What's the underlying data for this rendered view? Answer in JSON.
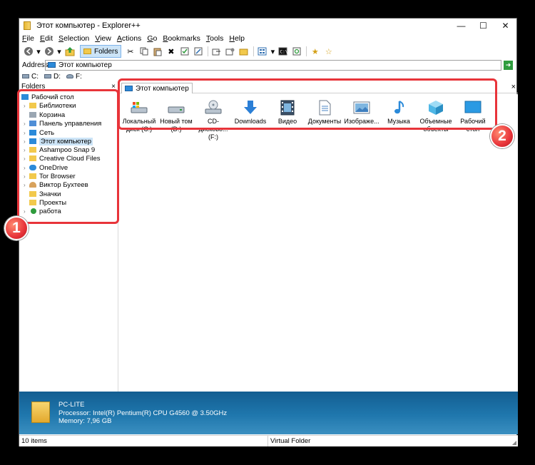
{
  "window": {
    "title": "Этот компьютер - Explorer++",
    "minimize": "—",
    "maximize": "☐",
    "close": "✕"
  },
  "menu": [
    {
      "first": "F",
      "rest": "ile"
    },
    {
      "first": "E",
      "rest": "dit"
    },
    {
      "first": "S",
      "rest": "election"
    },
    {
      "first": "V",
      "rest": "iew"
    },
    {
      "first": "A",
      "rest": "ctions"
    },
    {
      "first": "G",
      "rest": "o"
    },
    {
      "first": "B",
      "rest": "ookmarks"
    },
    {
      "first": "T",
      "rest": "ools"
    },
    {
      "first": "H",
      "rest": "elp"
    }
  ],
  "toolbar": {
    "folders_label": "Folders"
  },
  "address": {
    "label": "Address",
    "value": "Этот компьютер",
    "go": "➜"
  },
  "drives": [
    "C:",
    "D:",
    "F:"
  ],
  "folders_pane": {
    "title": "Folders",
    "close": "×",
    "items": [
      {
        "label": "Рабочий стол",
        "color": "#2b8ad9"
      },
      {
        "label": "Библиотеки",
        "color": "#f2c94c"
      },
      {
        "label": "Корзина",
        "color": "#9aa6b2"
      },
      {
        "label": "Панель управления",
        "color": "#4f8ed6"
      },
      {
        "label": "Сеть",
        "color": "#2b8ad9"
      },
      {
        "label": "Этот компьютер",
        "color": "#2b8ad9"
      },
      {
        "label": "Ashampoo Snap 9",
        "color": "#f2c94c"
      },
      {
        "label": "Creative Cloud Files",
        "color": "#f2c94c"
      },
      {
        "label": "OneDrive",
        "color": "#2b8ad9"
      },
      {
        "label": "Tor Browser",
        "color": "#f2c94c"
      },
      {
        "label": "Виктор Бухтеев",
        "color": "#d8a25c"
      },
      {
        "label": "Значки",
        "color": "#f2c94c"
      },
      {
        "label": "Проекты",
        "color": "#f2c94c"
      },
      {
        "label": "работа",
        "color": "#2e9b3c"
      }
    ]
  },
  "tab": {
    "label": "Этот компьютер",
    "close": "×"
  },
  "items": [
    {
      "line1": "Локальный",
      "line2": "диск (C:)",
      "color": "#5a8fcf"
    },
    {
      "line1": "Новый том",
      "line2": "(D:)",
      "color": "#8a97a6"
    },
    {
      "line1": "CD-дисково...",
      "line2": "(F:)",
      "color": "#9aa3ad"
    },
    {
      "line1": "Downloads",
      "line2": "",
      "color": "#2b7fd6"
    },
    {
      "line1": "Видео",
      "line2": "",
      "color": "#3a4f66"
    },
    {
      "line1": "Документы",
      "line2": "",
      "color": "#c7cfd8"
    },
    {
      "line1": "Изображе...",
      "line2": "",
      "color": "#5aa0dc"
    },
    {
      "line1": "Музыка",
      "line2": "",
      "color": "#2b8ad9"
    },
    {
      "line1": "Объемные",
      "line2": "объекты",
      "color": "#4fb7e6"
    },
    {
      "line1": "Рабочий",
      "line2": "стол",
      "color": "#2b9ae3"
    }
  ],
  "details": {
    "name": "PC-LITE",
    "processor": "Processor: Intel(R) Pentium(R) CPU G4560 @ 3.50GHz",
    "memory": "Memory: 7,96 GB"
  },
  "status": {
    "count": "10 items",
    "type": "Virtual Folder"
  },
  "annotations": {
    "badge1": "1",
    "badge2": "2",
    "color": "#e8343a"
  }
}
